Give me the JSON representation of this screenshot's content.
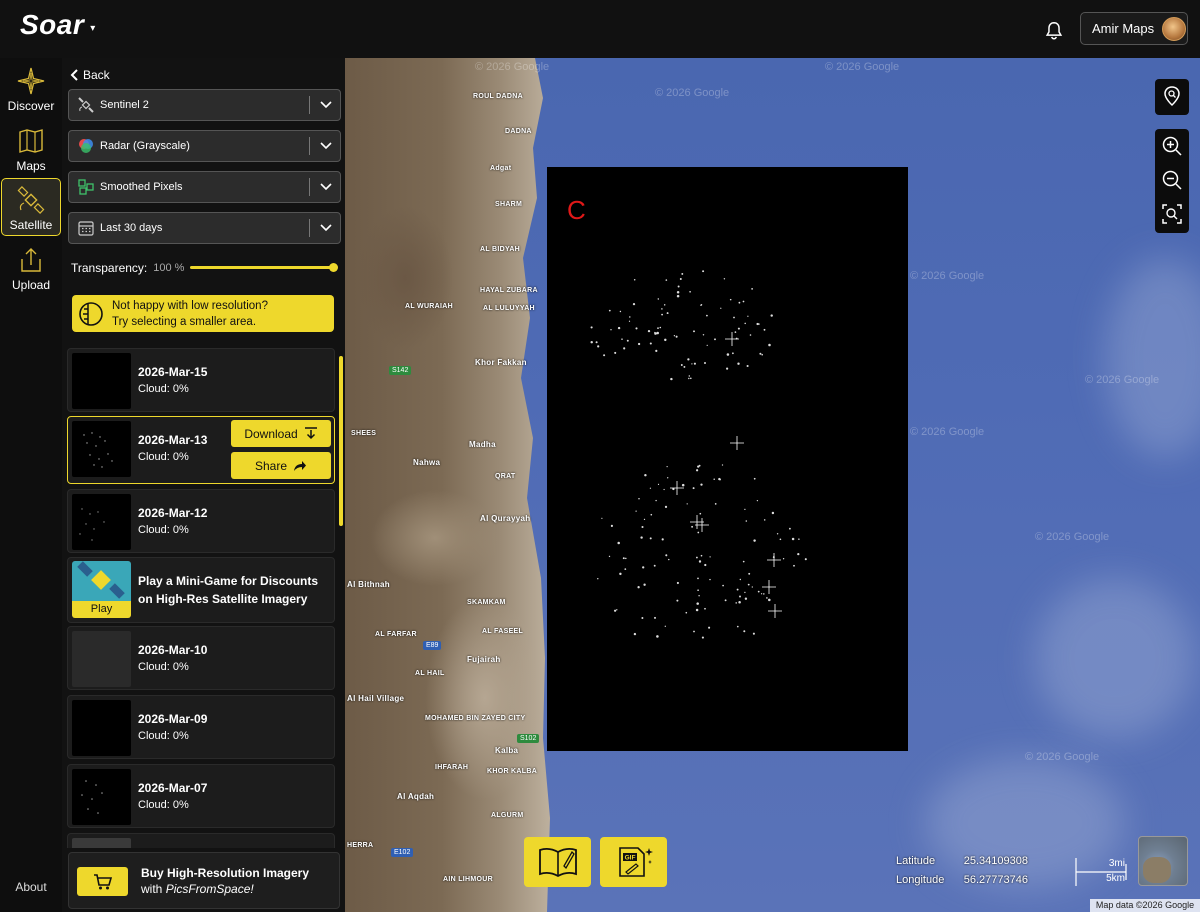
{
  "app": {
    "logo_text": "Soar"
  },
  "account": {
    "name": "Amir Maps"
  },
  "rail": {
    "items": [
      {
        "label": "Discover"
      },
      {
        "label": "Maps"
      },
      {
        "label": "Satellite"
      },
      {
        "label": "Upload"
      }
    ],
    "about": "About"
  },
  "panel": {
    "back_label": "Back",
    "dropdowns": [
      {
        "label": "Sentinel 2",
        "icon": "satellite-icon"
      },
      {
        "label": "Radar (Grayscale)",
        "icon": "radar-color-icon"
      },
      {
        "label": "Smoothed Pixels",
        "icon": "pixels-icon"
      },
      {
        "label": "Last 30 days",
        "icon": "calendar-icon"
      }
    ],
    "transparency": {
      "label": "Transparency:",
      "value": "100 %",
      "level": 1.0
    },
    "notice": {
      "line1": "Not happy with low resolution?",
      "line2": "Try selecting a smaller area."
    },
    "scenes": [
      {
        "date": "2026-Mar-15",
        "cloud": "Cloud: 0%"
      },
      {
        "date": "2026-Mar-13",
        "cloud": "Cloud: 0%",
        "download_label": "Download",
        "share_label": "Share"
      },
      {
        "date": "2026-Mar-12",
        "cloud": "Cloud: 0%"
      },
      {
        "date": "2026-Mar-10",
        "cloud": "Cloud: 0%"
      },
      {
        "date": "2026-Mar-09",
        "cloud": "Cloud: 0%"
      },
      {
        "date": "2026-Mar-07",
        "cloud": "Cloud: 0%"
      }
    ],
    "promo": {
      "title_line1": "Play a Mini-Game for Discounts",
      "title_line2": "on High-Res Satellite Imagery",
      "play_label": "Play"
    },
    "buy": {
      "title": "Buy High-Resolution Imagery",
      "sub_prefix": "with ",
      "sub_brand": "PicsFromSpace!"
    }
  },
  "overlay": {
    "label": "C"
  },
  "map": {
    "watermark": "© 2026 Google",
    "places": [
      "ROUL DADNA",
      "DADNA",
      "Adgat",
      "SHARM",
      "AL BIDYAH",
      "HAYAL ZUBARA",
      "AL LULUYYAH",
      "AL WURAIAH",
      "Khor Fakkan",
      "SHEES",
      "Nahwa",
      "Madha",
      "QRAT",
      "Al Qurayyah",
      "Al Bithnah",
      "SKAMKAM",
      "AL FARFAR",
      "AL FASEEL",
      "Fujairah",
      "AL HAIL",
      "Al Hail Village",
      "MOHAMED BIN ZAYED CITY",
      "Kalba",
      "IHFARAH",
      "KHOR KALBA",
      "Al Aqdah",
      "ALGURM",
      "AIN LIHMOUR",
      "HERRA"
    ],
    "roads": [
      "S142",
      "E89",
      "S102",
      "E102"
    ],
    "coords": {
      "lat_label": "Latitude",
      "lat_value": "25.34109308",
      "lon_label": "Longitude",
      "lon_value": "56.27773746"
    },
    "scale": {
      "top": "3mi",
      "bottom": "5km"
    },
    "attribution": "Map data ©2026 Google"
  },
  "colors": {
    "accent": "#eed82c",
    "panel": "#121212",
    "sea": "#4f6bb5",
    "overlay_label": "#e01818"
  }
}
